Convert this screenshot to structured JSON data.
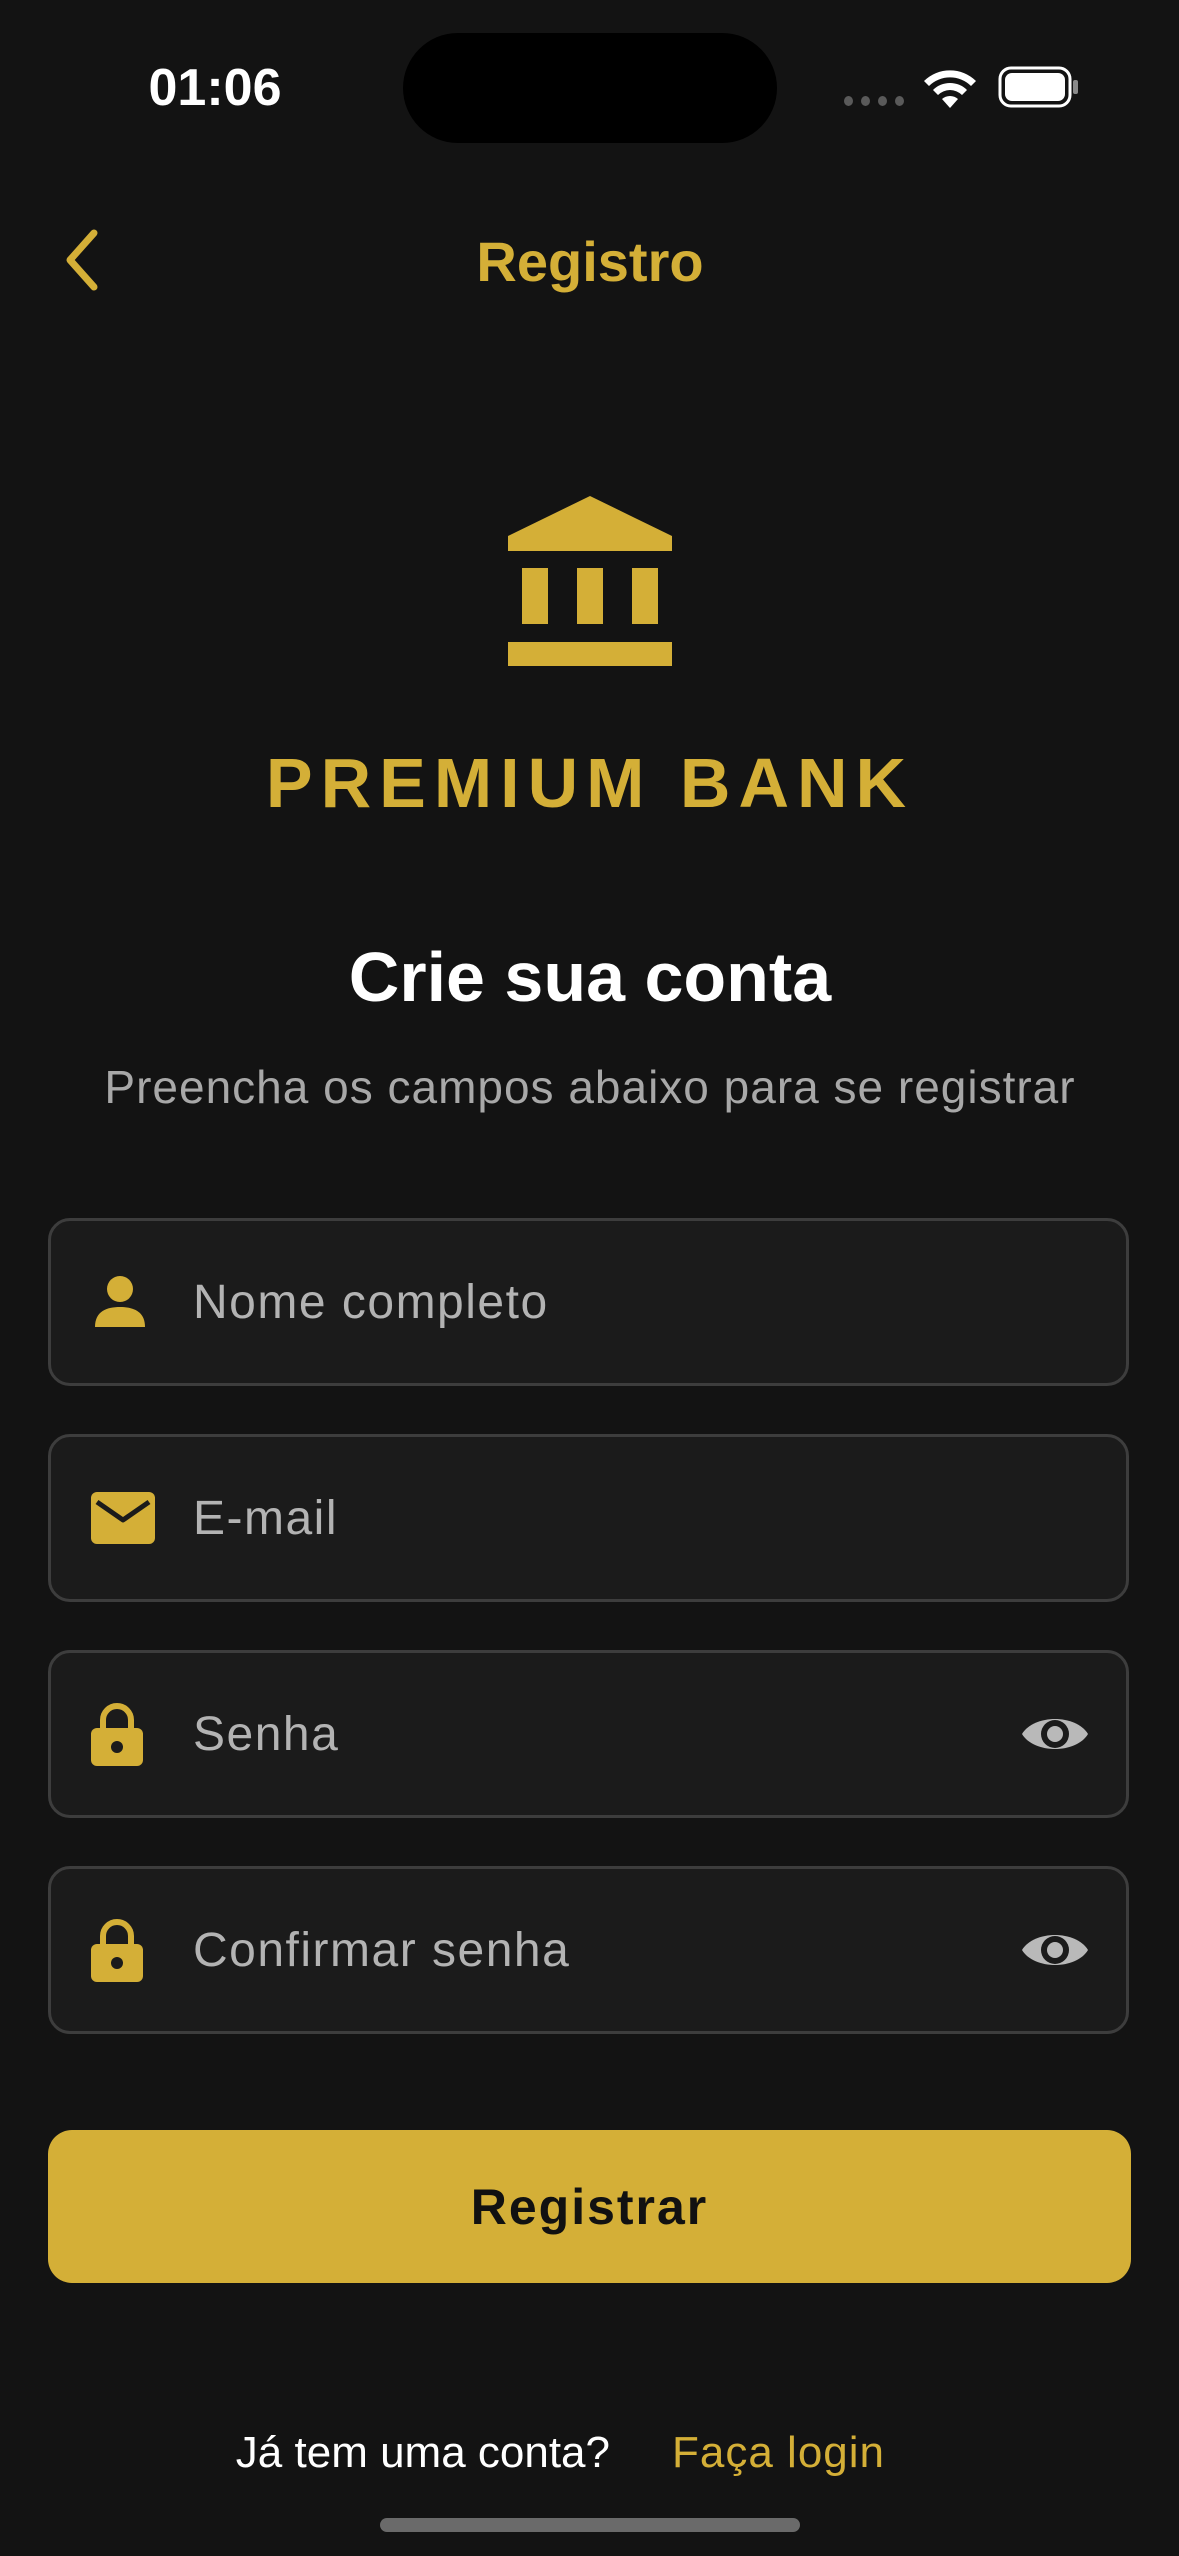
{
  "status_bar": {
    "time": "01:06"
  },
  "nav": {
    "title": "Registro",
    "back_icon": "chevron-left-icon"
  },
  "brand": {
    "logo_icon": "bank-icon",
    "name": "PREMIUM BANK"
  },
  "header": {
    "title": "Crie sua conta",
    "subtitle": "Preencha os campos abaixo para se registrar"
  },
  "form": {
    "name": {
      "placeholder": "Nome completo",
      "value": "",
      "icon": "person-icon"
    },
    "email": {
      "placeholder": "E-mail",
      "value": "",
      "icon": "mail-icon"
    },
    "password": {
      "placeholder": "Senha",
      "value": "",
      "icon": "lock-icon",
      "toggle_icon": "eye-icon"
    },
    "confirm_password": {
      "placeholder": "Confirmar senha",
      "value": "",
      "icon": "lock-icon",
      "toggle_icon": "eye-icon"
    }
  },
  "actions": {
    "register_label": "Registrar"
  },
  "footer": {
    "prompt": "Já tem uma conta?",
    "login_link": "Faça login"
  },
  "colors": {
    "background": "#131313",
    "accent": "#d4af37",
    "field_background": "#1b1b1b",
    "field_border": "#3d3d3d",
    "muted_text": "#a8a8a8"
  }
}
